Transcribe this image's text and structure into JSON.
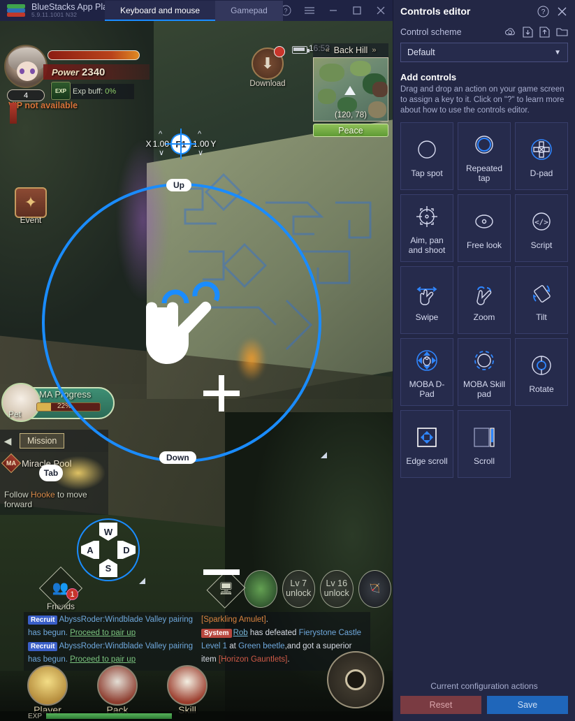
{
  "titlebar": {
    "app_name": "BlueStacks App Pla",
    "version": "5.9.11.1001  N32",
    "tabs": [
      {
        "label": "Keyboard and mouse",
        "active": true
      },
      {
        "label": "Gamepad",
        "active": false
      }
    ],
    "help_icon": "question-circle-icon",
    "menu_icon": "hamburger-menu-icon",
    "minimize_icon": "minimize-icon",
    "maximize_icon": "maximize-icon",
    "close_icon": "close-icon"
  },
  "game": {
    "player": {
      "level": "4",
      "power_label": "Power",
      "power_value": "2340",
      "exp_buff_label": "Exp buff:",
      "exp_buff_value": "0%",
      "exp_icon_text": "EXP",
      "vip_text": "VIP not available"
    },
    "event_button": {
      "label": "Event"
    },
    "download_button": {
      "label": "Download",
      "badge": ""
    },
    "status": {
      "clock": "16:53"
    },
    "minimap": {
      "location": "Back Hill",
      "coords": "(120, 78)",
      "state": "Peace"
    },
    "pet": {
      "label": "Pet",
      "progress_title": "MA Progress",
      "progress_pct": "22%"
    },
    "mission": {
      "tab_label": "Mission",
      "tag": "MA",
      "name": "Miracle Pool",
      "desc_prefix": "Follow ",
      "desc_npc": "Hooke",
      "desc_suffix": " to move forward"
    },
    "friends_button": {
      "label": "Friends",
      "badge": "1"
    },
    "skillbar": [
      {
        "label": "",
        "kind": "screen-icon"
      },
      {
        "label": "",
        "kind": "green-skill"
      },
      {
        "label": "Lv 7 unlock",
        "kind": "locked"
      },
      {
        "label": "Lv 16 unlock",
        "kind": "locked"
      },
      {
        "label": "",
        "kind": "bow-skill"
      }
    ],
    "chat": {
      "left": [
        {
          "tag": "Recruit",
          "tag_kind": "recruit",
          "parts": [
            {
              "text": "AbyssRoder:Windblade Valley pairing has begun. ",
              "color": "blue"
            },
            {
              "text": "Proceed to pair up",
              "color": "green"
            }
          ]
        },
        {
          "tag": "Recruit",
          "tag_kind": "recruit",
          "parts": [
            {
              "text": "AbyssRoder:Windblade Valley pairing has begun. ",
              "color": "blue"
            },
            {
              "text": "Proceed to pair up",
              "color": "green"
            }
          ]
        }
      ],
      "right": [
        {
          "tag": "",
          "tag_kind": "",
          "parts": [
            {
              "text": "[Sparkling Amulet]",
              "color": "orange"
            },
            {
              "text": ".",
              "color": "white"
            }
          ]
        },
        {
          "tag": "System",
          "tag_kind": "system",
          "parts": [
            {
              "text": "Rob",
              "color": "cyan"
            },
            {
              "text": " has defeated ",
              "color": "white"
            },
            {
              "text": "Fierystone Castle Level 1",
              "color": "blue"
            },
            {
              "text": " at ",
              "color": "white"
            },
            {
              "text": "Green beetle",
              "color": "blue"
            },
            {
              "text": ",and got a superior item ",
              "color": "white"
            },
            {
              "text": "[Horizon Gauntlets]",
              "color": "red"
            },
            {
              "text": ".",
              "color": "white"
            }
          ]
        }
      ],
      "settings_icon": "gear-icon"
    },
    "bottom_menu": [
      {
        "label": "Player"
      },
      {
        "label": "Pack"
      },
      {
        "label": "Skill"
      }
    ],
    "exp_bar": {
      "label": "EXP"
    }
  },
  "keymaps": {
    "aim": {
      "x_label": "X",
      "x_value": "1.00",
      "y_value": "1.00",
      "y_label": "Y",
      "key": "F1"
    },
    "zoom": {
      "up_label": "Up",
      "down_label": "Down"
    },
    "tab_key": {
      "key": "Tab"
    },
    "wasd": {
      "up": "W",
      "left": "A",
      "down": "S",
      "right": "D"
    }
  },
  "panel": {
    "title": "Controls editor",
    "help_icon": "question-circle-icon",
    "close_icon": "close-icon",
    "scheme_label": "Control scheme",
    "scheme_actions": [
      {
        "icon": "cloud-sync-icon"
      },
      {
        "icon": "import-icon"
      },
      {
        "icon": "export-icon"
      },
      {
        "icon": "folder-icon"
      }
    ],
    "scheme_value": "Default",
    "add_controls_title": "Add controls",
    "add_controls_desc": "Drag and drop an action on your game screen to assign a key to it. Click on \"?\" to learn more about how to use the controls editor.",
    "controls": [
      {
        "name": "Tap spot",
        "icon": "tap-spot-icon"
      },
      {
        "name": "Repeated tap",
        "icon": "repeated-tap-icon"
      },
      {
        "name": "D-pad",
        "icon": "d-pad-icon"
      },
      {
        "name": "Aim, pan and shoot",
        "icon": "aim-pan-shoot-icon"
      },
      {
        "name": "Free look",
        "icon": "free-look-icon"
      },
      {
        "name": "Script",
        "icon": "script-icon"
      },
      {
        "name": "Swipe",
        "icon": "swipe-icon"
      },
      {
        "name": "Zoom",
        "icon": "zoom-icon"
      },
      {
        "name": "Tilt",
        "icon": "tilt-icon"
      },
      {
        "name": "MOBA D-Pad",
        "icon": "moba-dpad-icon"
      },
      {
        "name": "MOBA Skill pad",
        "icon": "moba-skillpad-icon"
      },
      {
        "name": "Rotate",
        "icon": "rotate-icon"
      },
      {
        "name": "Edge scroll",
        "icon": "edge-scroll-icon"
      },
      {
        "name": "Scroll",
        "icon": "scroll-icon"
      }
    ],
    "footer_label": "Current configuration actions",
    "reset_label": "Reset",
    "save_label": "Save"
  },
  "colors": {
    "accent_blue": "#1a8cff",
    "panel_bg": "#232745",
    "cell_bg": "#262b4c",
    "save_btn": "#1f66ba",
    "reset_btn": "#7a3b42"
  }
}
